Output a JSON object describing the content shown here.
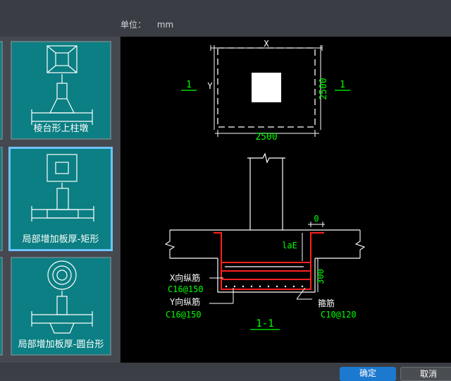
{
  "header": {
    "unit_label": "单位：",
    "unit_value": "mm"
  },
  "components": [
    {
      "label": "棱台形上柱墩",
      "selected": false
    },
    {
      "label": "局部增加板厚-矩形",
      "selected": true
    },
    {
      "label": "局部增加板厚-圆台形",
      "selected": false
    }
  ],
  "drawing": {
    "plan": {
      "x_label": "X",
      "y_label": "Y",
      "width_dim": "2500",
      "height_dim": "2500",
      "section_mark_left": "1",
      "section_mark_right": "1"
    },
    "section": {
      "title": "1-1",
      "cover_dim": "0",
      "anchor_label": "laE",
      "depth_dim": "300",
      "x_rebar_label": "X向纵筋",
      "x_rebar_spec": "C16@150",
      "y_rebar_label": "Y向纵筋",
      "y_rebar_spec": "C16@150",
      "stirrup_label": "箍筋",
      "stirrup_spec": "C10@120"
    }
  },
  "buttons": {
    "ok": "确定",
    "cancel": "取消"
  },
  "colors": {
    "card_bg": "#0b7f83",
    "selected_border": "#6ec3ff",
    "rebar": "#ff2020",
    "dimension": "#00ff00",
    "canvas_bg": "#000000"
  }
}
